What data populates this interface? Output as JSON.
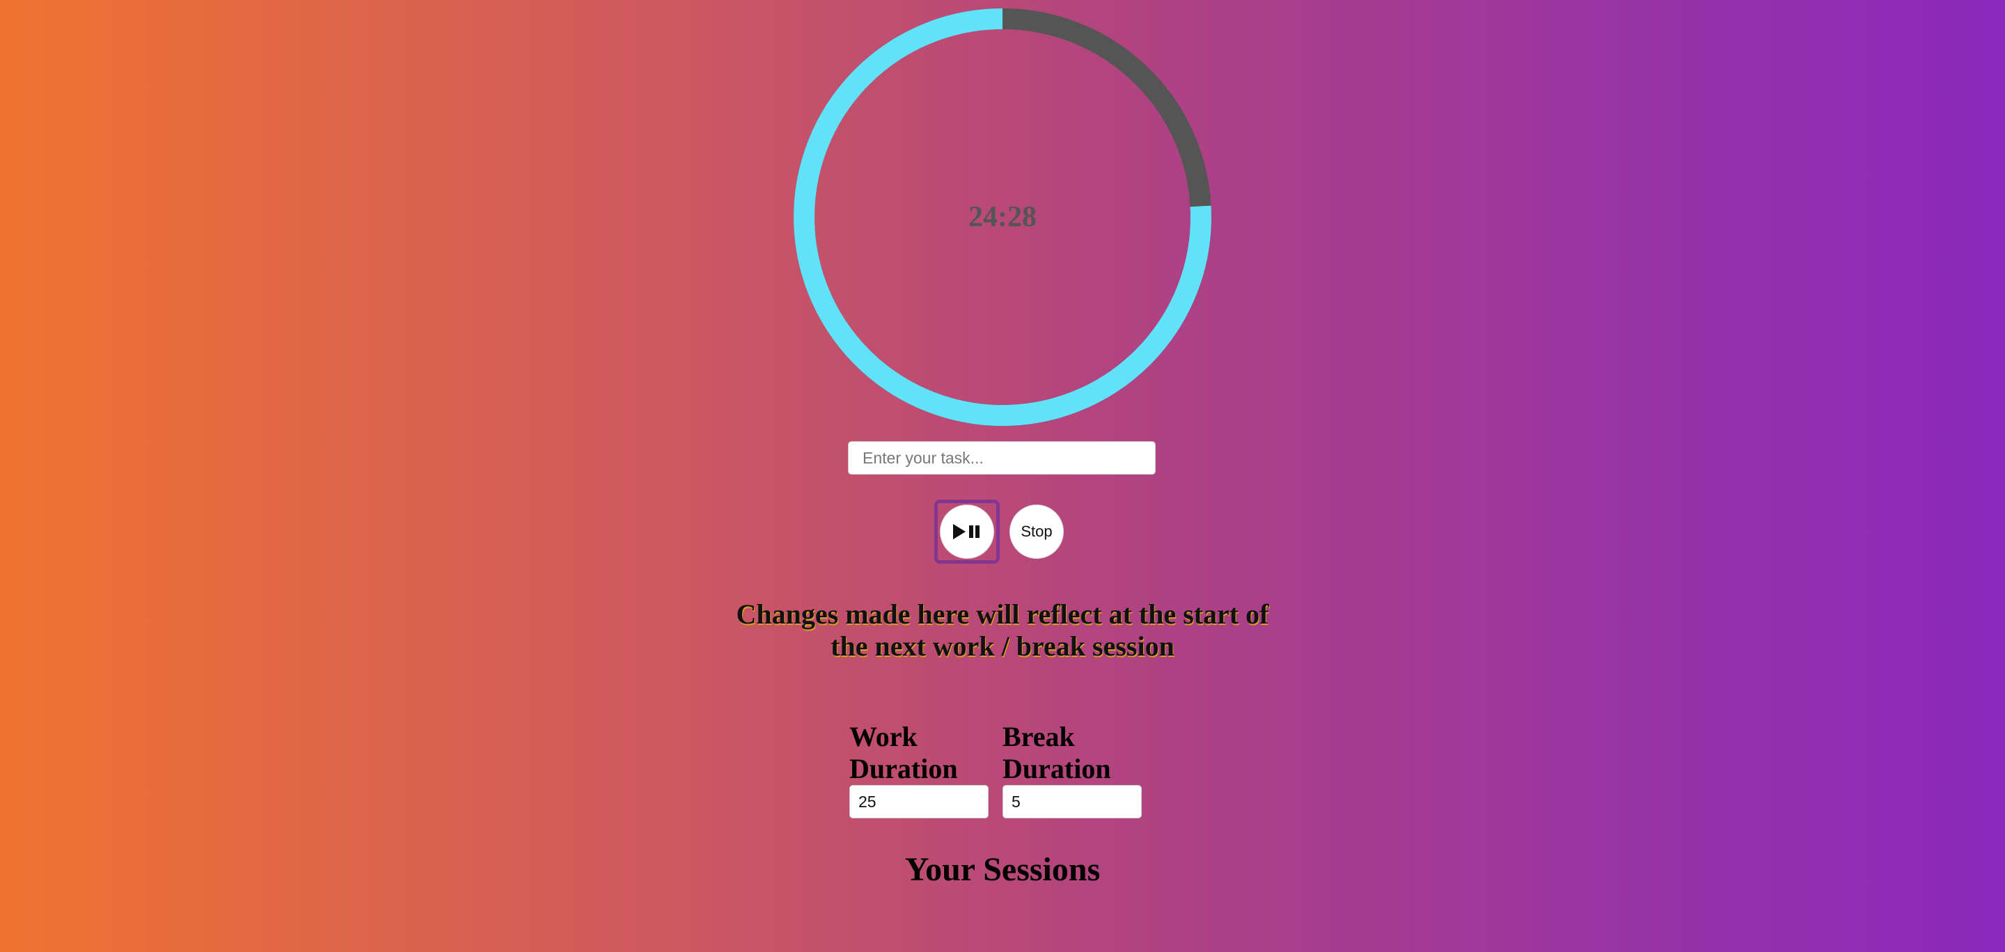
{
  "timer": {
    "display": "24:28",
    "progress_remaining": 0.7587,
    "ring_track_color": "#555555",
    "ring_progress_color": "#62e2f9"
  },
  "task": {
    "placeholder": "Enter your task...",
    "value": ""
  },
  "controls": {
    "play_pause_icon": "play-pause-icon",
    "stop_label": "Stop"
  },
  "notice": {
    "text": "Changes made here will reflect at the start of the next work / break session"
  },
  "settings": {
    "work_label": "Work Duration",
    "work_value": "25",
    "break_label": "Break Duration",
    "break_value": "5"
  },
  "sessions": {
    "title": "Your Sessions"
  }
}
